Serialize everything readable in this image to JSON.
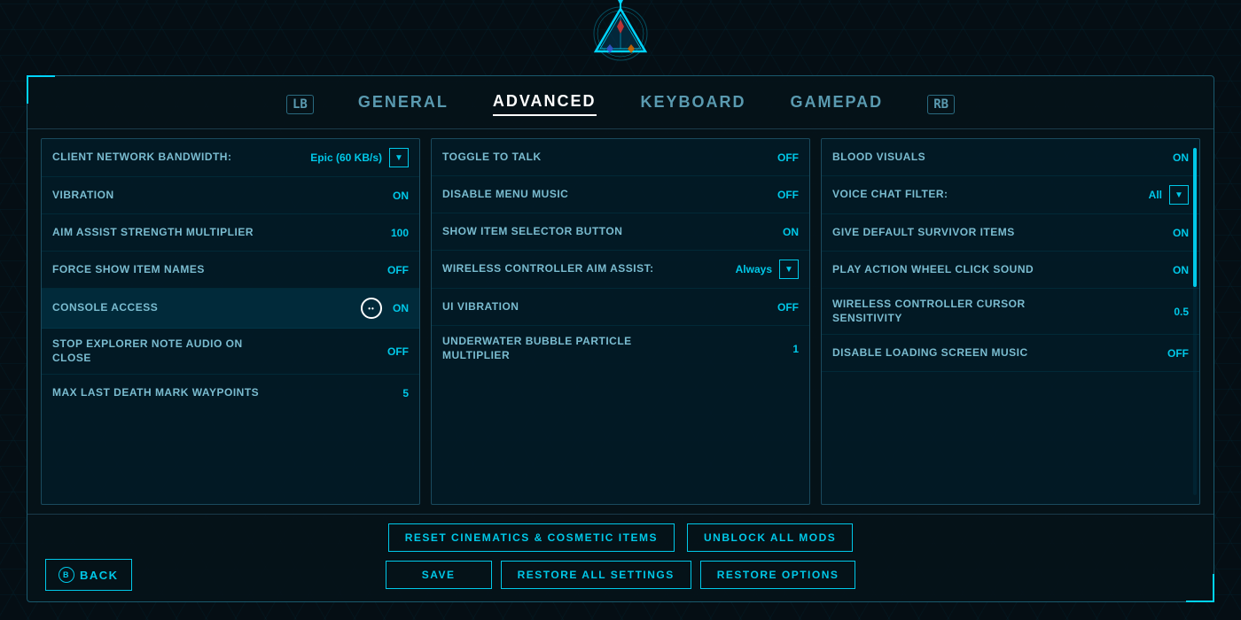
{
  "logo": {
    "alt": "ARK Logo"
  },
  "tabs": {
    "left_nav": "LB",
    "right_nav": "RB",
    "items": [
      {
        "id": "general",
        "label": "GENERAL",
        "active": false
      },
      {
        "id": "advanced",
        "label": "ADVANCED",
        "active": true
      },
      {
        "id": "keyboard",
        "label": "KEYBOARD",
        "active": false
      },
      {
        "id": "gamepad",
        "label": "GAMEPAD",
        "active": false
      }
    ]
  },
  "left_column": {
    "settings": [
      {
        "label": "Client Network Bandwidth:",
        "value": "Epic (60 KB/s)",
        "has_dropdown": true,
        "highlighted": false
      },
      {
        "label": "Vibration",
        "value": "ON",
        "has_dropdown": false,
        "highlighted": false
      },
      {
        "label": "Aim Assist Strength Multiplier",
        "value": "100",
        "has_dropdown": false,
        "highlighted": false
      },
      {
        "label": "Force Show Item Names",
        "value": "OFF",
        "has_dropdown": false,
        "highlighted": false
      },
      {
        "label": "Console Access",
        "value": "ON",
        "has_dropdown": false,
        "highlighted": true,
        "has_icon": true
      },
      {
        "label": "Stop Explorer Note Audio On Close",
        "value": "OFF",
        "has_dropdown": false,
        "highlighted": false
      },
      {
        "label": "Max Last Death Mark Waypoints",
        "value": "5",
        "has_dropdown": false,
        "highlighted": false
      }
    ]
  },
  "middle_column": {
    "settings": [
      {
        "label": "Toggle To Talk",
        "value": "OFF",
        "has_dropdown": false,
        "highlighted": false
      },
      {
        "label": "Disable Menu Music",
        "value": "OFF",
        "has_dropdown": false,
        "highlighted": false
      },
      {
        "label": "Show Item Selector Button",
        "value": "ON",
        "has_dropdown": false,
        "highlighted": false
      },
      {
        "label": "Wireless Controller Aim Assist:",
        "value": "Always",
        "has_dropdown": true,
        "highlighted": false
      },
      {
        "label": "UI Vibration",
        "value": "OFF",
        "has_dropdown": false,
        "highlighted": false
      },
      {
        "label": "Underwater Bubble Particle Multiplier",
        "value": "1",
        "has_dropdown": false,
        "highlighted": false
      }
    ]
  },
  "right_column": {
    "settings": [
      {
        "label": "Blood Visuals",
        "value": "ON",
        "has_dropdown": false,
        "highlighted": false
      },
      {
        "label": "Voice Chat Filter:",
        "value": "All",
        "has_dropdown": true,
        "highlighted": false
      },
      {
        "label": "Give Default Survivor Items",
        "value": "ON",
        "has_dropdown": false,
        "highlighted": false
      },
      {
        "label": "Play Action Wheel Click Sound",
        "value": "ON",
        "has_dropdown": false,
        "highlighted": false
      },
      {
        "label": "Wireless Controller Cursor Sensitivity",
        "value": "0.5",
        "has_dropdown": false,
        "highlighted": false
      },
      {
        "label": "Disable Loading Screen Music",
        "value": "OFF",
        "has_dropdown": false,
        "highlighted": false
      }
    ]
  },
  "bottom_buttons": {
    "row1": [
      {
        "id": "reset-cinematics",
        "label": "RESET CINEMATICS & COSMETIC ITEMS"
      },
      {
        "id": "unblock-mods",
        "label": "UNBLOCK ALL MODS"
      }
    ],
    "row2": [
      {
        "id": "back",
        "label": "BACK",
        "btn_letter": "B"
      },
      {
        "id": "save",
        "label": "SAVE"
      },
      {
        "id": "restore-all",
        "label": "RESTORE ALL SETTINGS"
      },
      {
        "id": "restore-options",
        "label": "RESTORE OPTIONS"
      }
    ]
  }
}
